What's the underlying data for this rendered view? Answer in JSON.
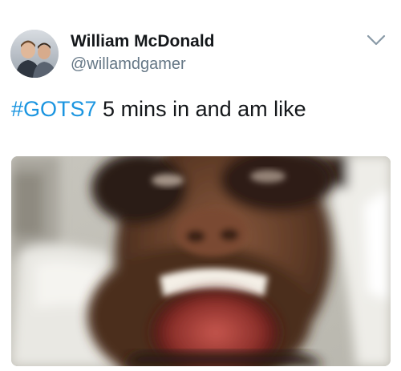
{
  "user": {
    "display_name": "William McDonald",
    "handle": "@willamdgamer",
    "avatar_icon": "profile-photo"
  },
  "tweet": {
    "hashtag": "#GOTS7",
    "text": " 5 mins in and am like"
  },
  "menu": {
    "icon": "chevron-down-icon"
  },
  "media": {
    "kind": "photo",
    "description_icon": "blurred-screaming-face-photo"
  },
  "colors": {
    "hashtag": "#1b95e0",
    "name": "#14171a",
    "handle": "#657786",
    "chevron": "#8899a6"
  }
}
